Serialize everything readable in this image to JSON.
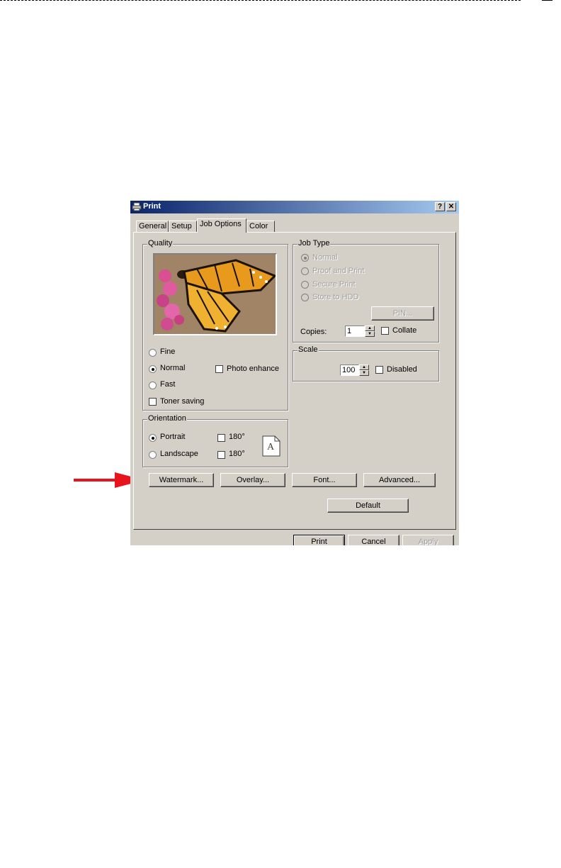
{
  "window": {
    "title": "Print",
    "help_label": "?",
    "close_label": "✕"
  },
  "tabs": [
    {
      "label": "General"
    },
    {
      "label": "Setup"
    },
    {
      "label": "Job Options",
      "active": true
    },
    {
      "label": "Color"
    }
  ],
  "quality": {
    "label": "Quality",
    "options": [
      {
        "label": "Fine",
        "selected": false
      },
      {
        "label": "Normal",
        "selected": true
      },
      {
        "label": "Fast",
        "selected": false
      }
    ],
    "photo_enhance": {
      "label": "Photo enhance",
      "checked": false
    },
    "toner_saving": {
      "label": "Toner saving",
      "checked": false
    }
  },
  "job_type": {
    "label": "Job Type",
    "options": [
      {
        "label": "Normal",
        "selected": true
      },
      {
        "label": "Proof and Print",
        "selected": false
      },
      {
        "label": "Secure Print",
        "selected": false
      },
      {
        "label": "Store to HDD",
        "selected": false
      }
    ],
    "pin_label": "PIN...",
    "copies_label": "Copies:",
    "copies_value": "1",
    "collate": {
      "label": "Collate",
      "checked": false
    }
  },
  "scale": {
    "label": "Scale",
    "value": "100",
    "disabled": {
      "label": "Disabled",
      "checked": false
    }
  },
  "orientation": {
    "label": "Orientation",
    "portrait": {
      "label": "Portrait",
      "selected": true
    },
    "landscape": {
      "label": "Landscape",
      "selected": false
    },
    "rotate_portrait": {
      "label": "180°",
      "checked": false
    },
    "rotate_landscape": {
      "label": "180°",
      "checked": false
    },
    "page_letter": "A"
  },
  "actions": {
    "watermark": "Watermark...",
    "overlay": "Overlay...",
    "font": "Font...",
    "advanced": "Advanced...",
    "default": "Default"
  },
  "footer": {
    "print": "Print",
    "cancel": "Cancel",
    "apply": "Apply"
  },
  "colors": {
    "title_start": "#0a246a",
    "title_end": "#a6caf0",
    "dialog_bg": "#d4d0c8",
    "arrow": "#e8141c"
  }
}
